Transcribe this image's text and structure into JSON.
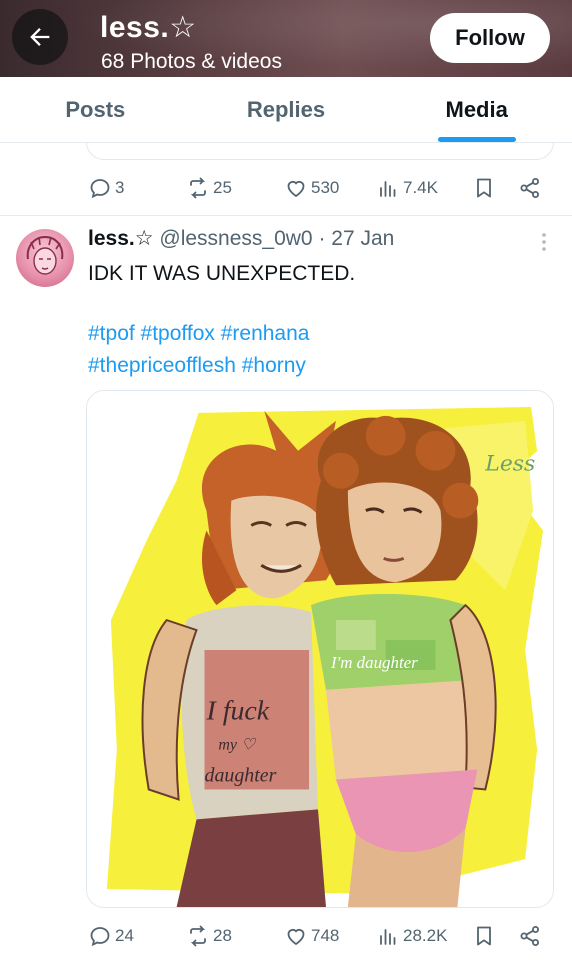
{
  "header": {
    "title": "less.☆",
    "subtitle": "68 Photos & videos",
    "follow_label": "Follow"
  },
  "tabs": [
    {
      "label": "Posts",
      "active": false
    },
    {
      "label": "Replies",
      "active": false
    },
    {
      "label": "Media",
      "active": true
    }
  ],
  "colors": {
    "accent": "#1d9bf0",
    "text": "#0f1419",
    "muted": "#536471"
  },
  "prev_tweet": {
    "replies": "3",
    "reposts": "25",
    "likes": "530",
    "views": "7.4K"
  },
  "tweet": {
    "name": "less.☆",
    "handle_date": " @lessness_0w0 · 27 Jan",
    "text": "IDK IT WAS UNEXPECTED.",
    "hashtags_line1": "#tpof #tpoffox #renhana",
    "hashtags_line2": "#thepriceofflesh #horny",
    "media": {
      "signature": "Less",
      "shirt_text_left": "I fuck my ♡ daughter",
      "shirt_text_right": "I'm daughter"
    },
    "stats": {
      "replies": "24",
      "reposts": "28",
      "likes": "748",
      "views": "28.2K"
    }
  },
  "icons": [
    "back-arrow-icon",
    "reply-icon",
    "repost-icon",
    "like-icon",
    "views-icon",
    "bookmark-icon",
    "share-icon",
    "more-icon"
  ]
}
